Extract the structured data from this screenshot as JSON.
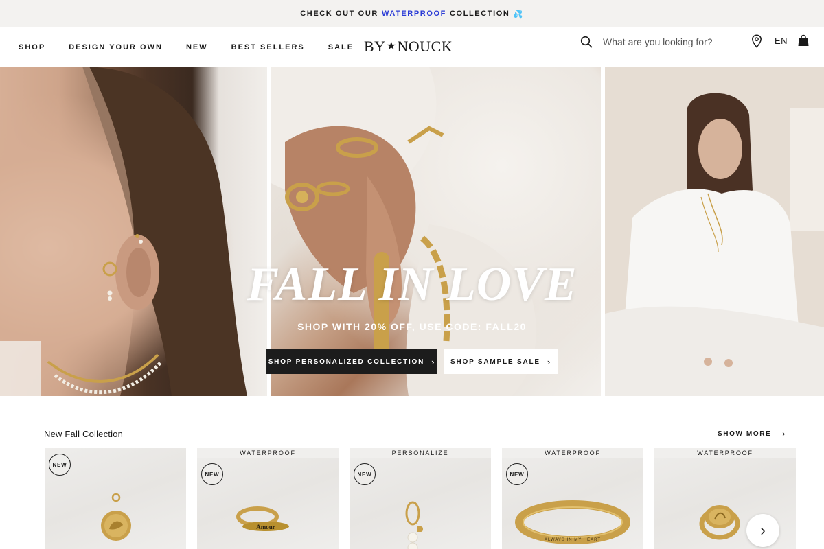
{
  "announcement": {
    "before": "CHECK OUT OUR",
    "highlight": "WATERPROOF",
    "after": "COLLECTION",
    "emoji": "💦"
  },
  "nav": {
    "items": [
      "SHOP",
      "DESIGN YOUR OWN",
      "NEW",
      "BEST SELLERS",
      "SALE"
    ]
  },
  "logo": {
    "left": "BY",
    "star": "★",
    "right": "NOUCK"
  },
  "search": {
    "placeholder": "What are you looking for?"
  },
  "header": {
    "language": "EN"
  },
  "hero": {
    "title": "FALL IN LOVE",
    "subtitle": "SHOP WITH 20% OFF, USE CODE: FALL20",
    "cta_primary": "SHOP PERSONALIZED COLLECTION",
    "cta_secondary": "SHOP SAMPLE SALE",
    "chevron": "›"
  },
  "collection": {
    "title": "New Fall Collection",
    "show_more": "SHOW MORE",
    "products": [
      {
        "tag": "",
        "badge": "NEW",
        "item": "coin-pendant"
      },
      {
        "tag": "WATERPROOF",
        "badge": "NEW",
        "item": "ring-amour",
        "engraving": "Amour"
      },
      {
        "tag": "PERSONALIZE",
        "badge": "NEW",
        "item": "initial-earring"
      },
      {
        "tag": "WATERPROOF",
        "badge": "NEW",
        "item": "bangle",
        "engraving": "ALWAYS IN MY HEART"
      },
      {
        "tag": "WATERPROOF",
        "badge": "",
        "item": "signet-ring"
      }
    ]
  },
  "colors": {
    "accent_blue": "#2a3bd6",
    "dark_button": "#1c1c1c",
    "announcement_bg": "#f3f2f0",
    "gold": "#c9a04a"
  }
}
